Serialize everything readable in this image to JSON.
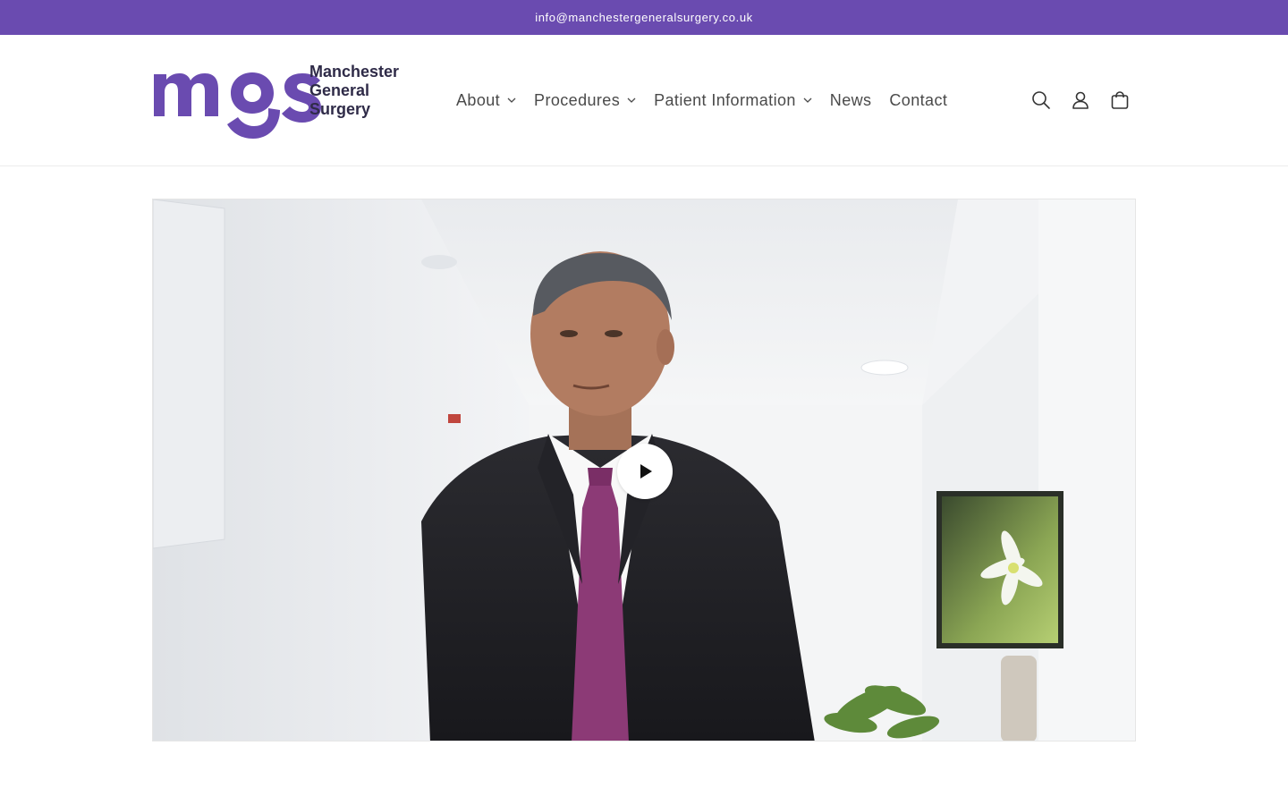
{
  "announcement": {
    "email": "info@manchestergeneralsurgery.co.uk"
  },
  "logo": {
    "mark": "mgs",
    "line1": "Manchester",
    "line2": "General",
    "line3": "Surgery",
    "color": "#6a4bb0"
  },
  "nav": {
    "items": [
      {
        "label": "About",
        "has_dropdown": true
      },
      {
        "label": "Procedures",
        "has_dropdown": true
      },
      {
        "label": "Patient Information",
        "has_dropdown": true
      },
      {
        "label": "News",
        "has_dropdown": false
      },
      {
        "label": "Contact",
        "has_dropdown": false
      }
    ]
  },
  "header_icons": [
    "search-icon",
    "account-icon",
    "cart-icon"
  ],
  "video": {
    "play_icon": "play-icon"
  },
  "colors": {
    "brand": "#6a4bb0",
    "text": "#4a4a4a"
  }
}
